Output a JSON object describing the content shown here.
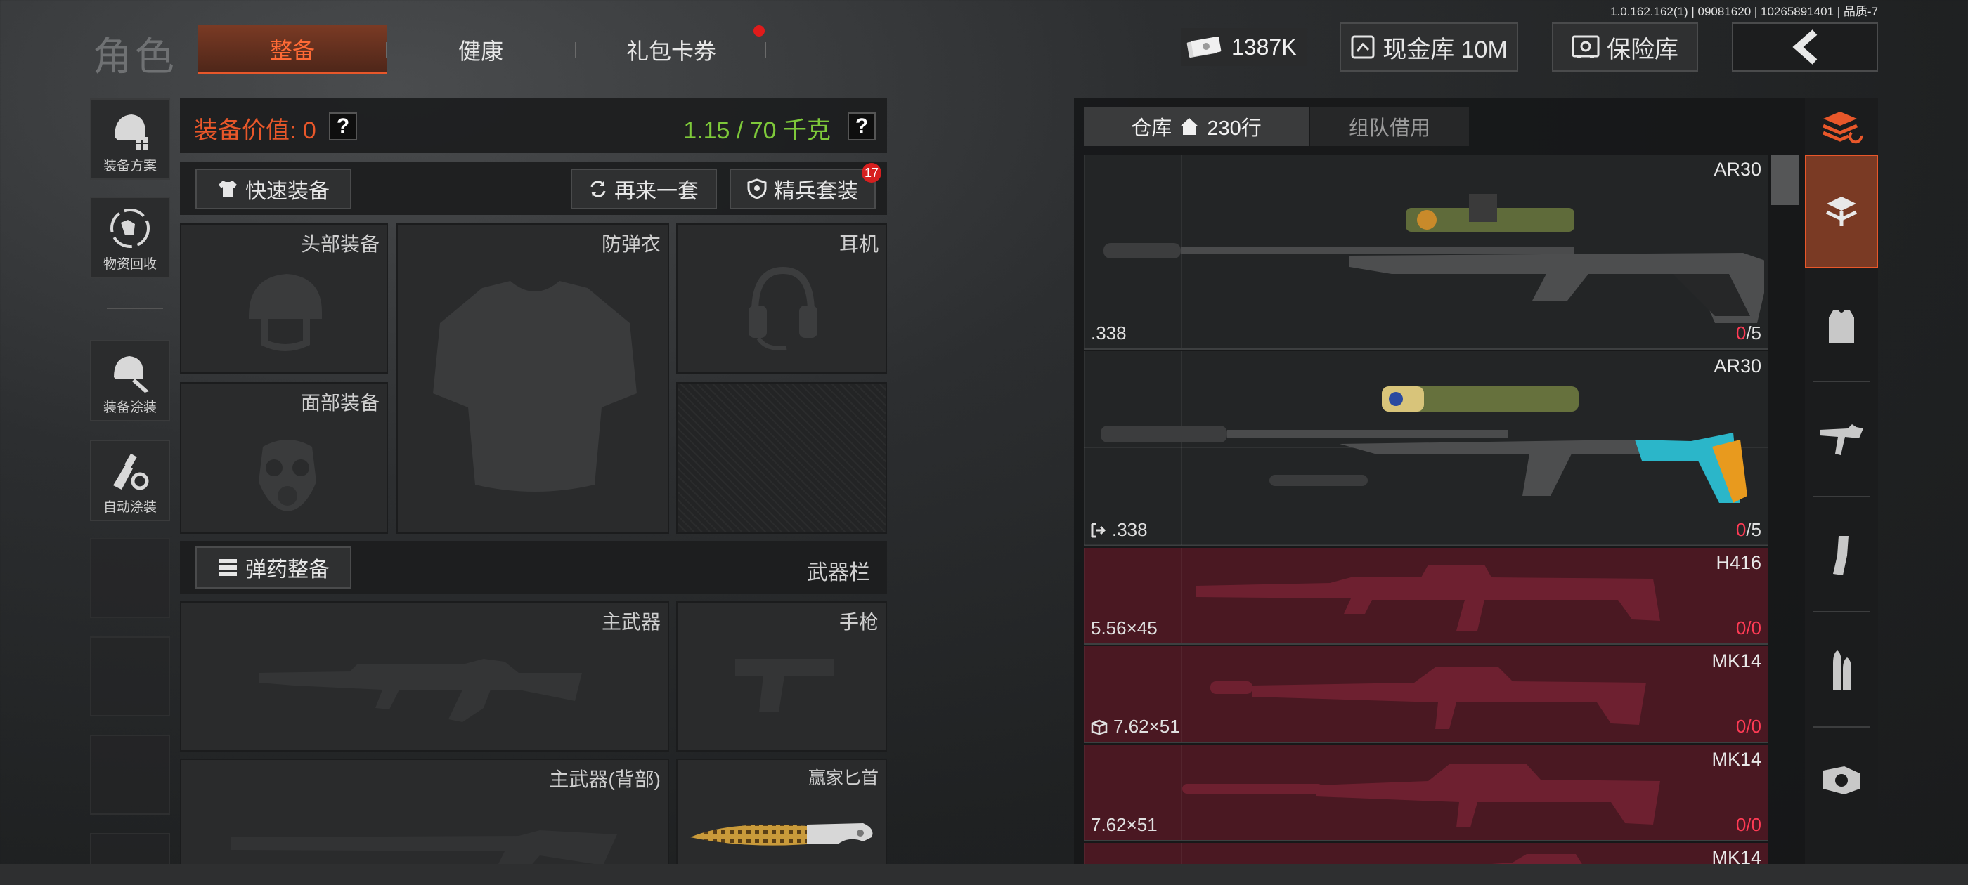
{
  "version_text": "1.0.162.162(1) | 09081620 | 10265891401 | 品质-7",
  "nav": {
    "title": "角色",
    "tabs": [
      {
        "label": "整备",
        "active": true
      },
      {
        "label": "健康",
        "active": false
      },
      {
        "label": "礼包卡券",
        "active": false,
        "dot": true
      }
    ]
  },
  "currency": {
    "money": "1387K",
    "cash_vault": "现金库 10M",
    "safe": "保险库"
  },
  "sidebar": {
    "items": [
      {
        "label": "装备方案",
        "icon": "helmet-plan-icon"
      },
      {
        "label": "物资回收",
        "icon": "recycle-icon"
      },
      {
        "label": "装备涂装",
        "icon": "paint-helmet-icon"
      },
      {
        "label": "自动涂装",
        "icon": "auto-paint-icon"
      }
    ]
  },
  "loadout": {
    "value_label": "装备价值: 0",
    "weight_label": "1.15 / 70 千克",
    "help": "?",
    "quick_equip": "快速装备",
    "again": "再来一套",
    "elite": "精兵套装",
    "elite_badge": "17",
    "slots": {
      "head": "头部装备",
      "armor": "防弹衣",
      "headset": "耳机",
      "face": "面部装备",
      "ammo_btn": "弹药整备",
      "weapon_bar": "武器栏",
      "primary": "主武器",
      "pistol": "手枪",
      "primary_back": "主武器(背部)",
      "melee": "赢家匕首"
    }
  },
  "storage": {
    "tab_storage": "仓库",
    "rows": "230行",
    "tab_team": "组队借用",
    "items": [
      {
        "name": "AR30",
        "caliber": ".338",
        "dur_a": "0",
        "dur_b": "/5",
        "style": "normal",
        "tag": ""
      },
      {
        "name": "AR30",
        "caliber": ".338",
        "dur_a": "0",
        "dur_b": "/5",
        "style": "normal",
        "tag": "exit"
      },
      {
        "name": "H416",
        "caliber": "5.56×45",
        "dur_a": "0",
        "dur_b": "/0",
        "style": "red",
        "tag": ""
      },
      {
        "name": "MK14",
        "caliber": "7.62×51",
        "dur_a": "0",
        "dur_b": "/0",
        "style": "red",
        "tag": "box"
      },
      {
        "name": "MK14",
        "caliber": "7.62×51",
        "dur_a": "0",
        "dur_b": "/0",
        "style": "red",
        "tag": ""
      },
      {
        "name": "MK14",
        "caliber": "",
        "dur_a": "",
        "dur_b": "",
        "style": "red",
        "tag": ""
      }
    ]
  },
  "right_tabs": [
    "all-stack-icon",
    "storage-stack-icon",
    "vest-icon",
    "rifle-icon",
    "magazine-icon",
    "bullet-icon",
    "scope-icon"
  ],
  "colors": {
    "accent": "#e8572a",
    "weight_green": "#7ec93a",
    "durability_red": "#ff3b55"
  }
}
